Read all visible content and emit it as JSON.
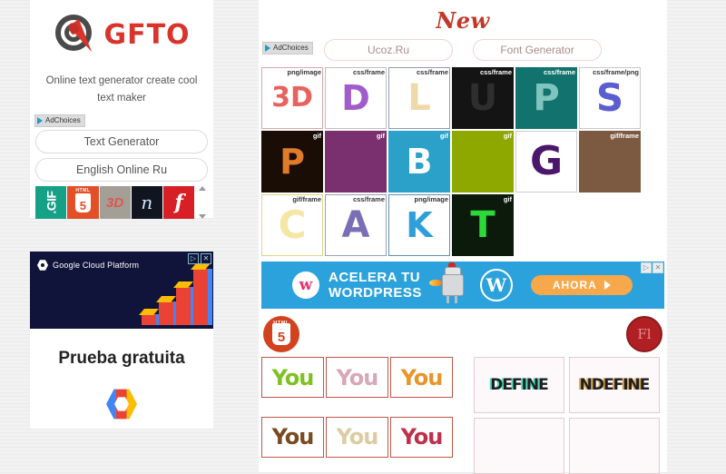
{
  "site": {
    "logo_text": "GFTO",
    "tagline": "Online text generator create cool text maker",
    "adchoices_label": "AdChoices"
  },
  "sidebar": {
    "buttons": [
      {
        "label": "Text Generator"
      },
      {
        "label": "English Online Ru"
      }
    ],
    "thumbnails": [
      {
        "name": "gif-thumb",
        "label": ".GIF"
      },
      {
        "name": "html5-thumb",
        "label": "5",
        "sub": "HTML"
      },
      {
        "name": "3d-thumb",
        "label": "3D"
      },
      {
        "name": "script-n-thumb",
        "label": "n"
      },
      {
        "name": "flash-thumb",
        "label": "f"
      }
    ]
  },
  "google_ad": {
    "brand": "Google Cloud Platform",
    "title": "Prueba gratuita",
    "close_icons": [
      "▷",
      "✕"
    ]
  },
  "main": {
    "title": "New",
    "adchoices_label": "AdChoices",
    "top_buttons": [
      {
        "label": "Ucoz.Ru"
      },
      {
        "label": "Font Generator"
      }
    ],
    "tiles": [
      {
        "tag": "png/image",
        "glyph": "3D",
        "glyph_color": "#e8625e",
        "bg": "#ffffff",
        "border": "#d9a7a7",
        "tag_color": "#333333",
        "font_size": "30px"
      },
      {
        "tag": "css/frame",
        "glyph": "D",
        "glyph_color": "#a05ccb",
        "bg": "#ffffff",
        "border": "#bfbfbf",
        "tag_color": "#333333",
        "font_size": "38px"
      },
      {
        "tag": "css/frame",
        "glyph": "L",
        "glyph_color": "#efd9a8",
        "bg": "#ffffff",
        "border": "#8f9bb3",
        "tag_color": "#333333",
        "font_size": "40px"
      },
      {
        "tag": "css/frame",
        "glyph": "U",
        "glyph_color": "#2e2e2e",
        "bg": "#141414",
        "border": "#141414",
        "tag_color": "#ffffff",
        "font_size": "40px"
      },
      {
        "tag": "css/frame",
        "glyph": "P",
        "glyph_color": "#7fc4bd",
        "bg": "#12736e",
        "border": "#12736e",
        "tag_color": "#ffffff",
        "font_size": "40px"
      },
      {
        "tag": "css/frame/png",
        "glyph": "S",
        "glyph_color": "#5b5ed0",
        "bg": "#ffffff",
        "border": "#c8c8c8",
        "tag_color": "#333333",
        "font_size": "42px"
      },
      {
        "tag": "gif",
        "glyph": "P",
        "glyph_color": "#e07b2a",
        "bg": "#190d06",
        "border": "#190d06",
        "tag_color": "#ffffff",
        "font_size": "38px"
      },
      {
        "tag": "gif",
        "glyph": "",
        "glyph_color": "#e364c0",
        "bg": "#7a2f6e",
        "border": "#7a2f6e",
        "tag_color": "#ffffff",
        "font_size": "38px"
      },
      {
        "tag": "gif",
        "glyph": "B",
        "glyph_color": "#ffffff",
        "bg": "#2ba0c9",
        "border": "#2ba0c9",
        "tag_color": "#ffffff",
        "font_size": "38px"
      },
      {
        "tag": "gif",
        "glyph": "",
        "glyph_color": "#8fa800",
        "bg": "#8fa800",
        "border": "#8fa800",
        "tag_color": "#ffffff",
        "font_size": "38px"
      },
      {
        "tag": "",
        "glyph": "G",
        "glyph_color": "#4b176b",
        "bg": "#ffffff",
        "border": "#cccccc",
        "tag_color": "#333333",
        "font_size": "44px"
      },
      {
        "tag": "gif/frame",
        "glyph": "",
        "glyph_color": "#a8apos",
        "bg": "#7b5a41",
        "border": "#7b5a41",
        "tag_color": "#ffffff",
        "font_size": "38px"
      },
      {
        "tag": "gif/frame",
        "glyph": "C",
        "glyph_color": "#f4e7a4",
        "bg": "#ffffff",
        "border": "#ddd48a",
        "tag_color": "#333333",
        "font_size": "42px"
      },
      {
        "tag": "css/frame",
        "glyph": "A",
        "glyph_color": "#7a6fb5",
        "bg": "#ffffff",
        "border": "#9aa0b5",
        "tag_color": "#333333",
        "font_size": "40px"
      },
      {
        "tag": "png/image",
        "glyph": "K",
        "glyph_color": "#2f9fd8",
        "bg": "#ffffff",
        "border": "#5f8fb0",
        "tag_color": "#333333",
        "font_size": "38px"
      },
      {
        "tag": "gif",
        "glyph": "T",
        "glyph_color": "#2bd93a",
        "bg": "#0b1a0b",
        "border": "#0b1a0b",
        "tag_color": "#ffffff",
        "font_size": "40px"
      }
    ],
    "banner": {
      "line1": "ACELERA TU",
      "line2": "WORDPRESS",
      "brand_mark": "w",
      "wp_mark": "W",
      "cta": "AHORA",
      "close_icons": [
        "▷",
        "✕"
      ]
    },
    "badges": {
      "html5_label": "5",
      "html5_sub": "HTML",
      "flash_label": "Fl"
    },
    "you_samples": [
      {
        "text": "You",
        "color": "#7ec124"
      },
      {
        "text": "You",
        "color": "#d7a8b8"
      },
      {
        "text": "You",
        "color": "#e8962a"
      },
      {
        "text": "You",
        "color": "#7a4a22"
      },
      {
        "text": "You",
        "color": "#ddcba4"
      },
      {
        "text": "You",
        "color": "#c0304a"
      }
    ],
    "define_samples": [
      {
        "text": "DEFINE",
        "color": "#1f1f1f",
        "accent": "#4fd8c0"
      },
      {
        "text": "NDEFINE",
        "color": "#1f1f1f",
        "accent": "#d8a24f"
      },
      {
        "text": "",
        "color": "#1f1f1f",
        "accent": "#cccccc"
      },
      {
        "text": "",
        "color": "#1f1f1f",
        "accent": "#cccccc"
      }
    ]
  }
}
